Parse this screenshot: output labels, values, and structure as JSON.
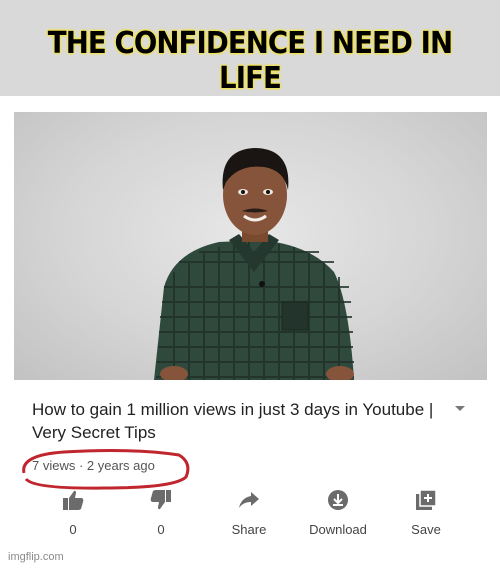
{
  "caption": "THE CONFIDENCE I NEED IN LIFE",
  "video": {
    "title": "How to gain 1 million views in just 3 days in Youtube | Very Secret Tips",
    "meta": "7 views · 2 years ago"
  },
  "actions": [
    {
      "icon": "thumbs-up-icon",
      "label": "0"
    },
    {
      "icon": "thumbs-down-icon",
      "label": "0"
    },
    {
      "icon": "share-icon",
      "label": "Share"
    },
    {
      "icon": "download-icon",
      "label": "Download"
    },
    {
      "icon": "save-icon",
      "label": "Save"
    }
  ],
  "watermark": "imgflip.com",
  "colors": {
    "caption_glow": "#f3e23a",
    "circle": "#c0262e",
    "icon": "#6b6b6b"
  }
}
